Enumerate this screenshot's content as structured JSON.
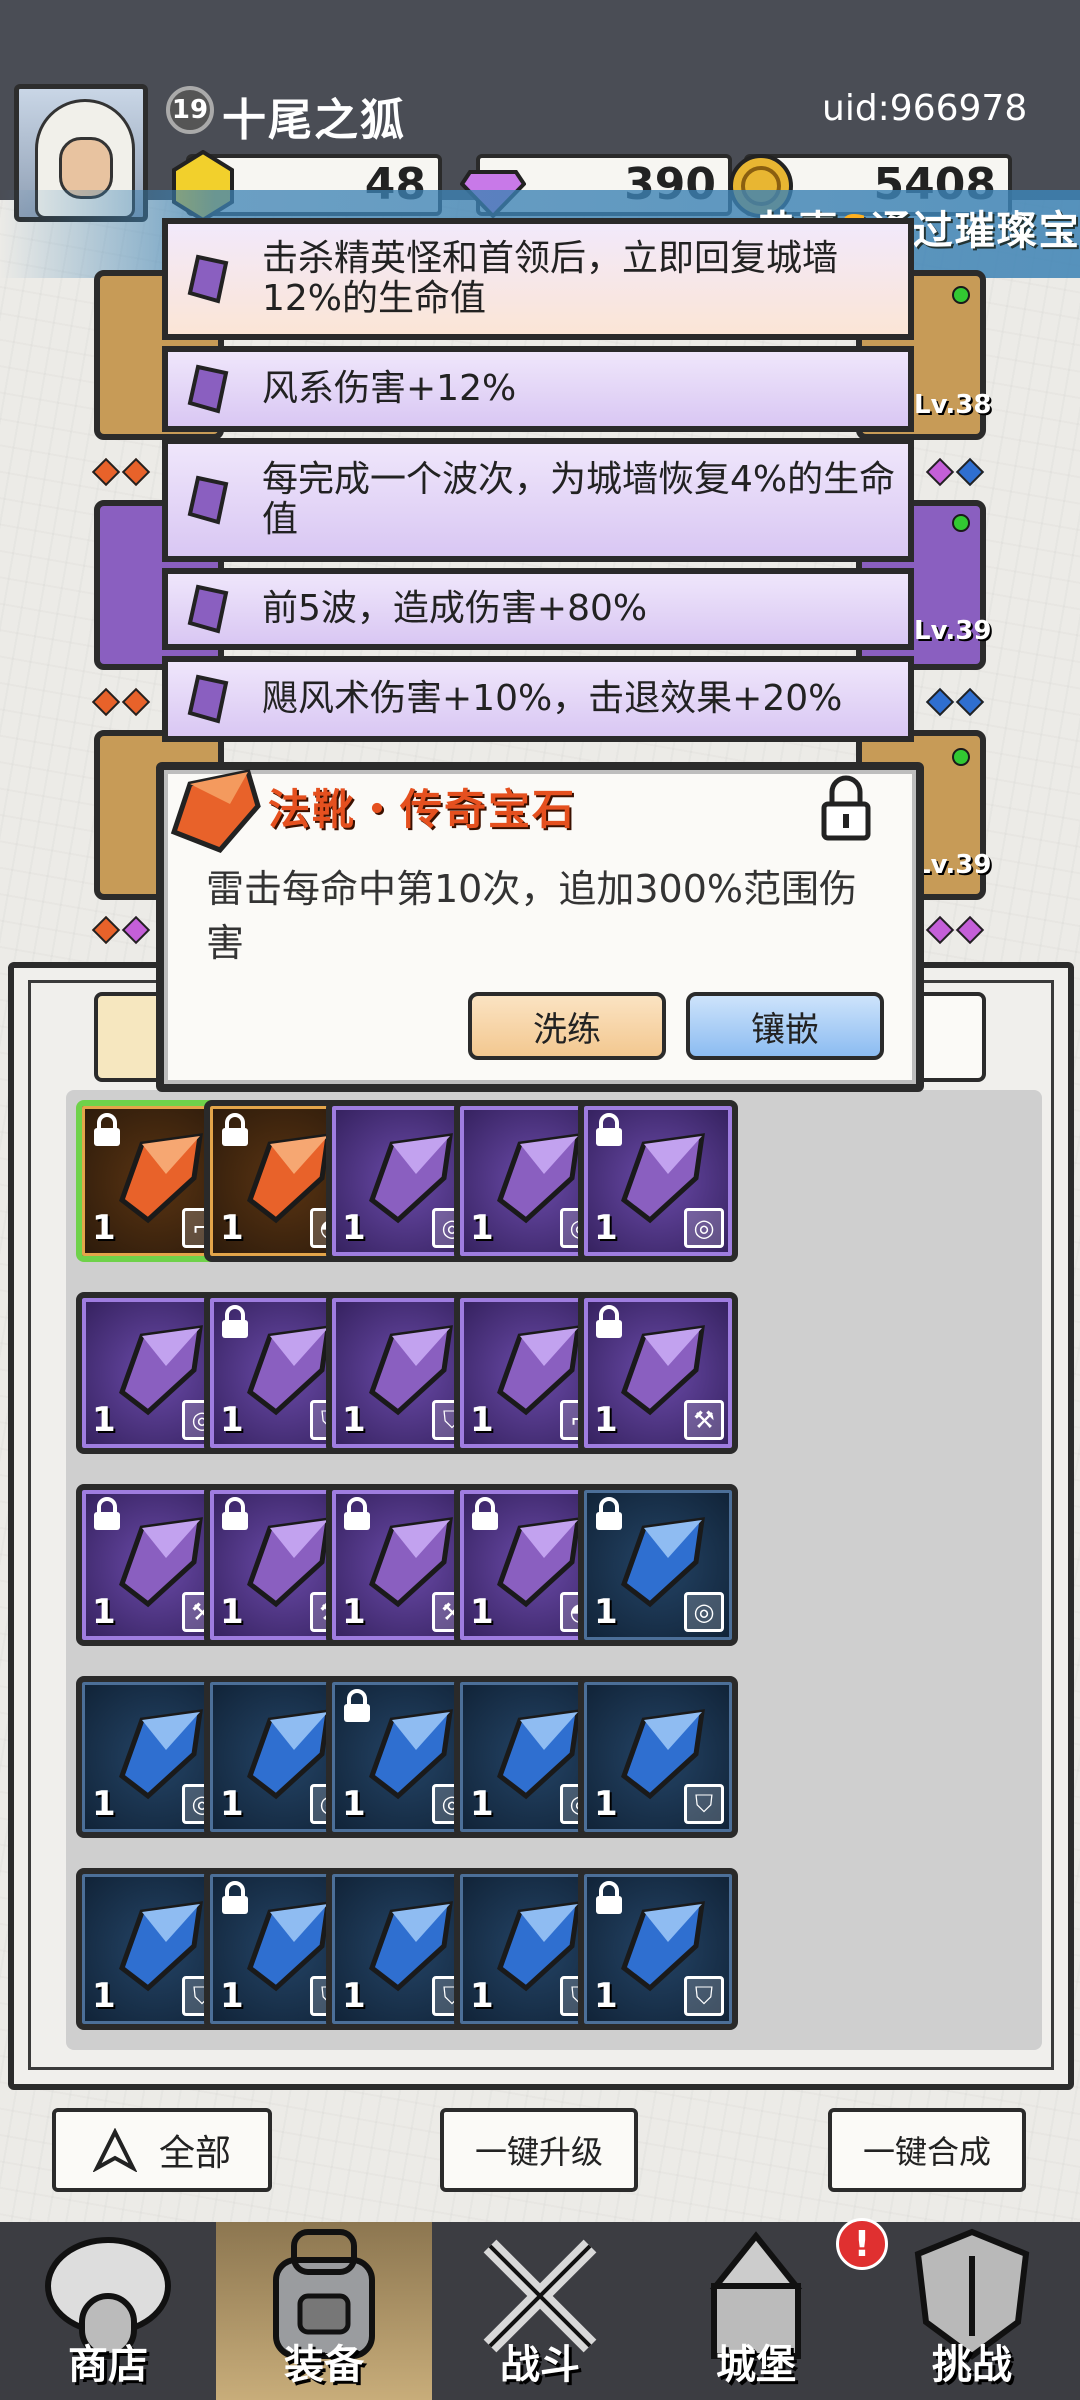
{
  "player": {
    "level": "19",
    "name": "十尾之狐",
    "uid": "uid:966978"
  },
  "resources": {
    "gold": "48",
    "gems": "390",
    "coins": "5408"
  },
  "marquee": {
    "prefix": "恭喜",
    "grade": "S",
    "suffix": "通过璀璨宝"
  },
  "equipment_levels": [
    "Lv.38",
    "Lv.39",
    "Lv.39"
  ],
  "affixes": [
    "击杀精英怪和首领后，立即回复城墙12%的生命值",
    "风系伤害+12%",
    "每完成一个波次，为城墙恢复4%的生命值",
    "前5波，造成伤害+80%",
    "飓风术伤害+10%，击退效果+20%"
  ],
  "popup": {
    "title": "法靴・传奇宝石",
    "description": "雷击每命中第10次，追加300%范围伤害",
    "refine_label": "洗练",
    "inlay_label": "镶嵌"
  },
  "inventory": [
    {
      "rarity": "legend",
      "locked": true,
      "slot": "boot",
      "qty": "1",
      "selected": true
    },
    {
      "rarity": "legend",
      "locked": true,
      "slot": "helmet",
      "qty": "1"
    },
    {
      "rarity": "epic",
      "locked": false,
      "slot": "ring",
      "qty": "1"
    },
    {
      "rarity": "epic",
      "locked": false,
      "slot": "ring",
      "qty": "1"
    },
    {
      "rarity": "epic",
      "locked": true,
      "slot": "ring",
      "qty": "1"
    },
    {
      "rarity": "epic",
      "locked": false,
      "slot": "ring",
      "qty": "1"
    },
    {
      "rarity": "epic",
      "locked": true,
      "slot": "armor",
      "qty": "1"
    },
    {
      "rarity": "epic",
      "locked": false,
      "slot": "armor",
      "qty": "1"
    },
    {
      "rarity": "epic",
      "locked": false,
      "slot": "boot",
      "qty": "1"
    },
    {
      "rarity": "epic",
      "locked": true,
      "slot": "weapon",
      "qty": "1"
    },
    {
      "rarity": "epic",
      "locked": true,
      "slot": "weapon",
      "qty": "1"
    },
    {
      "rarity": "epic",
      "locked": true,
      "slot": "weapon",
      "qty": "1"
    },
    {
      "rarity": "epic",
      "locked": true,
      "slot": "weapon",
      "qty": "1"
    },
    {
      "rarity": "epic",
      "locked": true,
      "slot": "helmet",
      "qty": "1"
    },
    {
      "rarity": "rare",
      "locked": true,
      "slot": "ring",
      "qty": "1"
    },
    {
      "rarity": "rare",
      "locked": false,
      "slot": "ring",
      "qty": "1"
    },
    {
      "rarity": "rare",
      "locked": false,
      "slot": "ring",
      "qty": "1"
    },
    {
      "rarity": "rare",
      "locked": true,
      "slot": "ring",
      "qty": "1"
    },
    {
      "rarity": "rare",
      "locked": false,
      "slot": "ring",
      "qty": "1"
    },
    {
      "rarity": "rare",
      "locked": false,
      "slot": "armor",
      "qty": "1"
    },
    {
      "rarity": "rare",
      "locked": false,
      "slot": "armor",
      "qty": "1"
    },
    {
      "rarity": "rare",
      "locked": true,
      "slot": "armor",
      "qty": "1"
    },
    {
      "rarity": "rare",
      "locked": false,
      "slot": "armor",
      "qty": "1"
    },
    {
      "rarity": "rare",
      "locked": false,
      "slot": "armor",
      "qty": "1"
    },
    {
      "rarity": "rare",
      "locked": true,
      "slot": "armor",
      "qty": "1"
    }
  ],
  "actions": {
    "filter_label": "全部",
    "upgrade_all": "一键升级",
    "merge_all": "一键合成"
  },
  "nav": [
    {
      "label": "商店",
      "icon": "shop-icon"
    },
    {
      "label": "装备",
      "icon": "backpack-icon",
      "active": true
    },
    {
      "label": "战斗",
      "icon": "crossed-swords-icon"
    },
    {
      "label": "城堡",
      "icon": "castle-icon",
      "alert": "!"
    },
    {
      "label": "挑战",
      "icon": "shield-challenge-icon"
    }
  ],
  "colors": {
    "legend": "#e8622a",
    "epic": "#8a5fc0",
    "rare": "#2f6fd0",
    "accent": "#e5501f"
  }
}
